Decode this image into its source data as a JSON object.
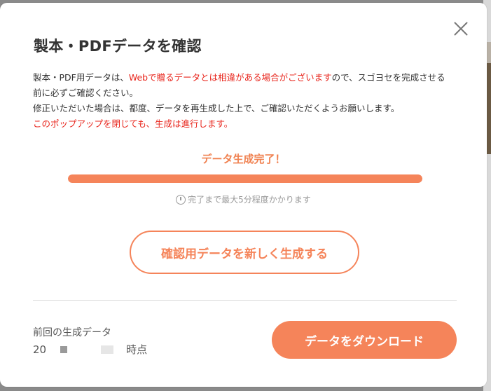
{
  "modal": {
    "title": "製本・PDFデータを確認",
    "desc": {
      "line1_a": "製本・PDF用データは、",
      "line1_red": "Webで贈るデータとは相違がある場合がございます",
      "line1_b": "ので、スゴヨセを完成させる前に必ずご確認ください。",
      "line2": "修正いただいた場合は、都度、データを再生成した上で、ご確認いただくようお願いします。",
      "line3_red": "このポップアップを閉じても、生成は進行します。"
    },
    "status": "データ生成完了！",
    "progress": 1.0,
    "time_hint": "完了まで最大5分程度かかります",
    "regen_label": "確認用データを新しく生成する",
    "prev_label": "前回の生成データ",
    "prev_year": "20",
    "prev_suffix": "時点",
    "download_label": "データをダウンロード"
  },
  "colors": {
    "accent": "#f5845a",
    "warning": "#e8241b"
  },
  "icons": {
    "close": "close-icon",
    "timer": "timer-icon"
  }
}
